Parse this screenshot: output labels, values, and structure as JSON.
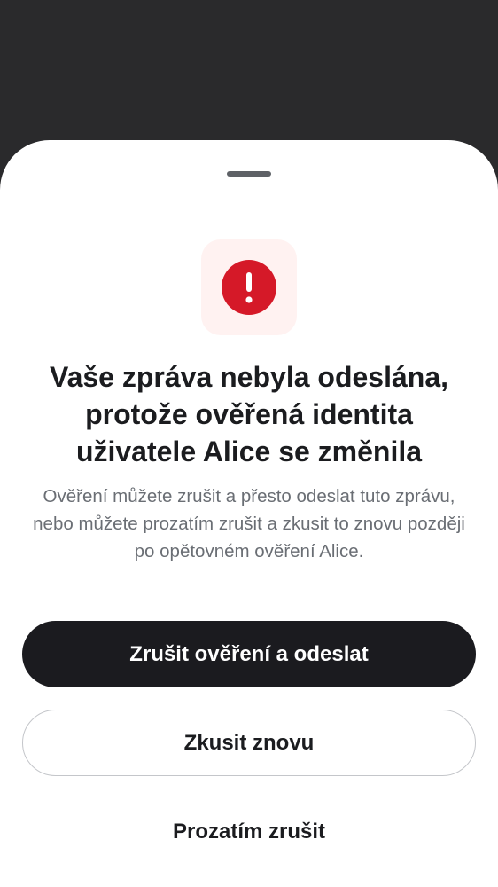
{
  "sheet": {
    "icon": "exclamation-circle-icon",
    "title": "Vaše zpráva nebyla odeslána, protože ověřená identita uživatele Alice se změnila",
    "body": "Ověření můžete zrušit a přesto odeslat tuto zprávu, nebo můžete prozatím zrušit a zkusit to znovu později po opětovném ověření Alice.",
    "primary_button_label": "Zrušit ověření a odeslat",
    "secondary_button_label": "Zkusit znovu",
    "text_button_label": "Prozatím zrušit"
  },
  "colors": {
    "backdrop": "#2a2a2c",
    "sheet": "#ffffff",
    "alert_red": "#d51928",
    "icon_tile": "#fff2f1",
    "primary_button": "#1b1b1f",
    "body_text": "#6a6e74"
  }
}
